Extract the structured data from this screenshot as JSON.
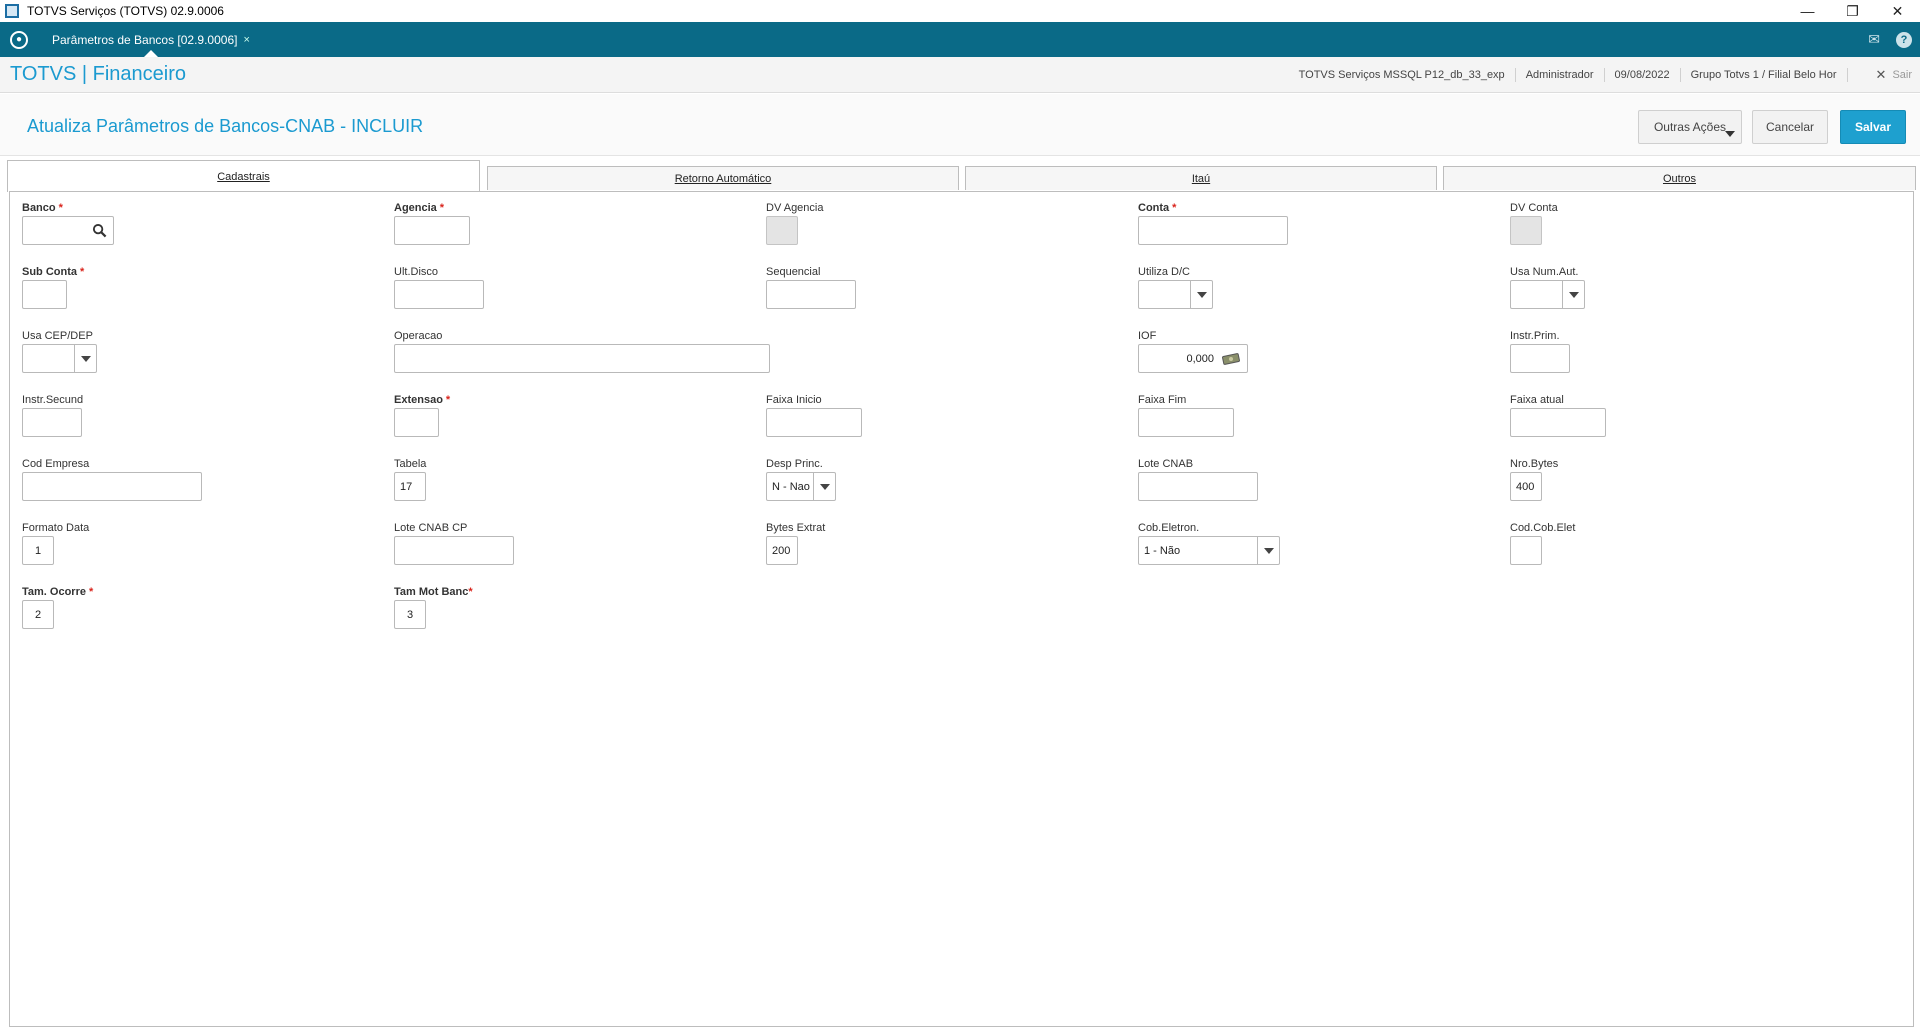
{
  "window": {
    "title": "TOTVS Serviços (TOTVS) 02.9.0006"
  },
  "tabbar": {
    "active_tab": "Parâmetros de Bancos [02.9.0006]",
    "close_glyph": "×"
  },
  "header": {
    "brand": "TOTVS | Financeiro",
    "environment": "TOTVS Serviços MSSQL P12_db_33_exp",
    "user": "Administrador",
    "date": "09/08/2022",
    "branch": "Grupo Totvs 1 / Filial Belo Hor",
    "exit_label": "Sair"
  },
  "page": {
    "title": "Atualiza Parâmetros de Bancos-CNAB - INCLUIR",
    "other_actions": "Outras Ações",
    "cancel": "Cancelar",
    "save": "Salvar"
  },
  "folders": [
    "Cadastrais",
    "Retorno Automático",
    "Itaú",
    "Outros"
  ],
  "fields": {
    "banco": {
      "label": "Banco",
      "value": ""
    },
    "agencia": {
      "label": "Agencia",
      "value": ""
    },
    "dv_agencia": {
      "label": "DV Agencia",
      "value": ""
    },
    "conta": {
      "label": "Conta",
      "value": ""
    },
    "dv_conta": {
      "label": "DV Conta",
      "value": ""
    },
    "sub_conta": {
      "label": "Sub Conta",
      "value": ""
    },
    "ult_disco": {
      "label": "Ult.Disco",
      "value": ""
    },
    "sequencial": {
      "label": "Sequencial",
      "value": ""
    },
    "utiliza_dc": {
      "label": "Utiliza D/C",
      "value": ""
    },
    "usa_num_aut": {
      "label": "Usa Num.Aut.",
      "value": ""
    },
    "usa_cep_dep": {
      "label": "Usa CEP/DEP",
      "value": ""
    },
    "operacao": {
      "label": "Operacao",
      "value": ""
    },
    "iof": {
      "label": "IOF",
      "value": "0,000"
    },
    "instr_prim": {
      "label": "Instr.Prim.",
      "value": ""
    },
    "instr_secund": {
      "label": "Instr.Secund",
      "value": ""
    },
    "extensao": {
      "label": "Extensao",
      "value": ""
    },
    "faixa_inicio": {
      "label": "Faixa Inicio",
      "value": ""
    },
    "faixa_fim": {
      "label": "Faixa Fim",
      "value": ""
    },
    "faixa_atual": {
      "label": "Faixa atual",
      "value": ""
    },
    "cod_empresa": {
      "label": "Cod Empresa",
      "value": ""
    },
    "tabela": {
      "label": "Tabela",
      "value": "17"
    },
    "desp_princ": {
      "label": "Desp Princ.",
      "value": "N - Nao"
    },
    "lote_cnab": {
      "label": "Lote CNAB",
      "value": ""
    },
    "nro_bytes": {
      "label": "Nro.Bytes",
      "value": "400"
    },
    "formato_data": {
      "label": "Formato Data",
      "value": "1"
    },
    "lote_cnab_cp": {
      "label": "Lote CNAB CP",
      "value": ""
    },
    "bytes_extrat": {
      "label": "Bytes Extrat",
      "value": "200"
    },
    "cob_eletron": {
      "label": "Cob.Eletron.",
      "value": "1 - Não"
    },
    "cod_cob_elet": {
      "label": "Cod.Cob.Elet",
      "value": ""
    },
    "tam_ocorre": {
      "label": "Tam. Ocorre",
      "value": "2"
    },
    "tam_mot_banc": {
      "label": "Tam Mot Banc",
      "value": "3"
    }
  },
  "colors": {
    "accent": "#1b9ad0",
    "tabbar": "#0a6a87",
    "save": "#1ea0cf",
    "required": "#d9241c"
  },
  "icons": {
    "banco_lookup": "search-icon",
    "iof_calc": "money-icon"
  }
}
